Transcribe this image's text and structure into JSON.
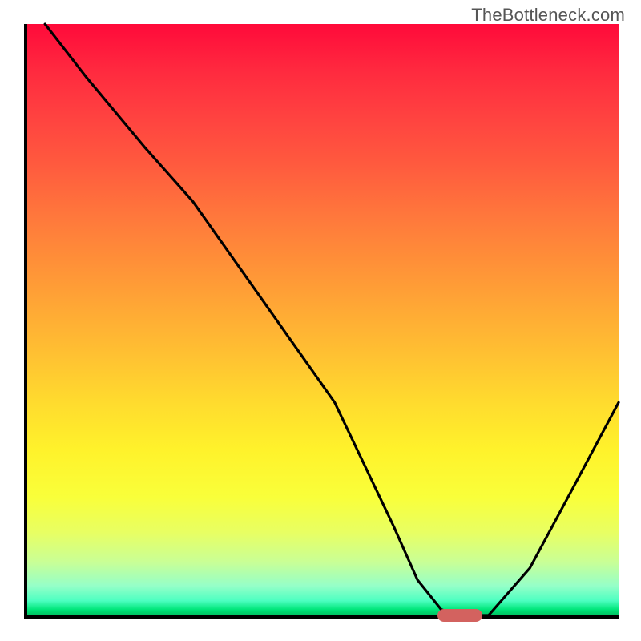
{
  "watermark": "TheBottleneck.com",
  "chart_data": {
    "type": "line",
    "title": "",
    "xlabel": "",
    "ylabel": "",
    "xlim": [
      0,
      100
    ],
    "ylim": [
      0,
      100
    ],
    "grid": false,
    "series": [
      {
        "name": "curve",
        "x": [
          3,
          10,
          20,
          28,
          40,
          52,
          62,
          66,
          70,
          73,
          78,
          85,
          92,
          100
        ],
        "values": [
          100,
          91,
          79,
          70,
          53,
          36,
          15,
          6,
          1,
          0,
          0,
          8,
          21,
          36
        ]
      }
    ],
    "marker": {
      "x_start": 69,
      "x_end": 76.5,
      "y": 0
    },
    "gradient": {
      "stops": [
        {
          "pct": 0,
          "color": "#ff0a3a"
        },
        {
          "pct": 50,
          "color": "#ffa835"
        },
        {
          "pct": 80,
          "color": "#f9ff3a"
        },
        {
          "pct": 100,
          "color": "#00c060"
        }
      ]
    }
  }
}
